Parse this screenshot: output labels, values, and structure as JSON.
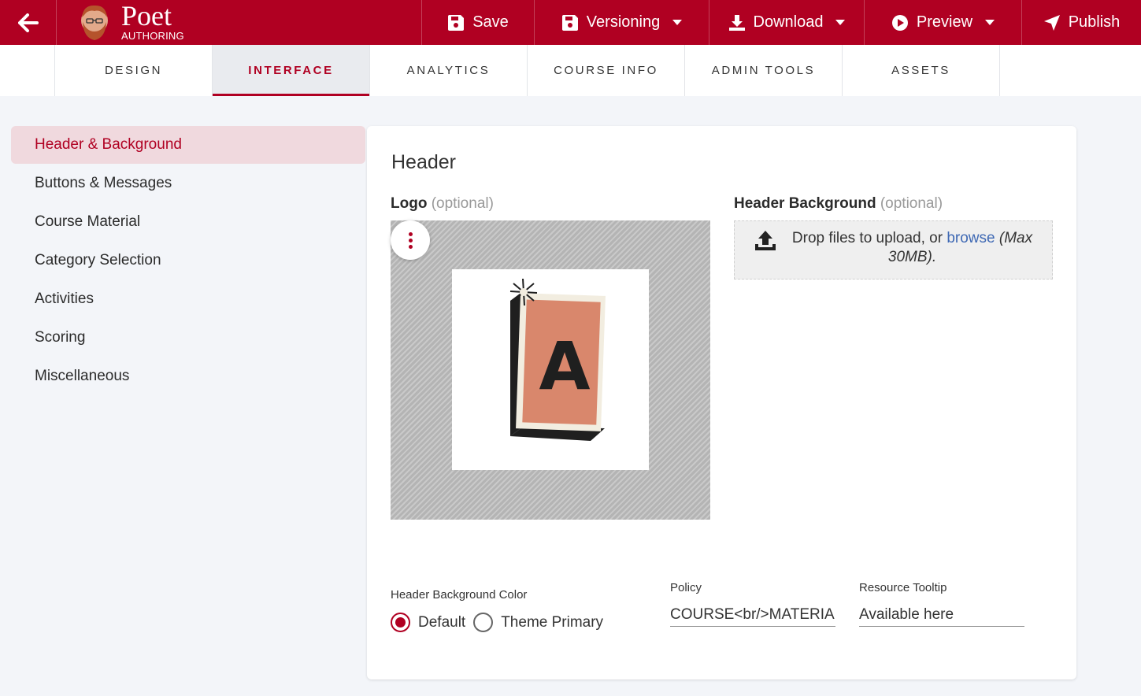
{
  "app": {
    "name": "Poet",
    "subtitle": "AUTHORING"
  },
  "toolbar": {
    "back_icon": "arrow-left-icon",
    "save_label": "Save",
    "versioning_label": "Versioning",
    "download_label": "Download",
    "preview_label": "Preview",
    "publish_label": "Publish"
  },
  "tabs": [
    {
      "label": "DESIGN",
      "active": false
    },
    {
      "label": "INTERFACE",
      "active": true
    },
    {
      "label": "ANALYTICS",
      "active": false
    },
    {
      "label": "COURSE INFO",
      "active": false
    },
    {
      "label": "ADMIN TOOLS",
      "active": false
    },
    {
      "label": "ASSETS",
      "active": false
    }
  ],
  "sidebar": {
    "items": [
      {
        "label": "Header & Background",
        "active": true
      },
      {
        "label": "Buttons & Messages"
      },
      {
        "label": "Course Material"
      },
      {
        "label": "Category Selection"
      },
      {
        "label": "Activities"
      },
      {
        "label": "Scoring"
      },
      {
        "label": "Miscellaneous"
      }
    ]
  },
  "main": {
    "title": "Header",
    "logo": {
      "label": "Logo",
      "optional": "(optional)",
      "image_letter": "A"
    },
    "header_background": {
      "label": "Header Background",
      "optional": "(optional)",
      "drop_text": "Drop files to upload, or",
      "browse": "browse",
      "limit": "(Max 30MB)."
    },
    "bg_color": {
      "label": "Header Background Color",
      "options": [
        "Default",
        "Theme Primary"
      ],
      "selected": "Default"
    },
    "policy": {
      "label": "Policy",
      "value": "COURSE<br/>MATERIA"
    },
    "resource_tooltip": {
      "label": "Resource Tooltip",
      "value": "Available here"
    }
  },
  "colors": {
    "brand": "#b00022",
    "active_bg": "#f0d9de",
    "link": "#3f69b4"
  }
}
